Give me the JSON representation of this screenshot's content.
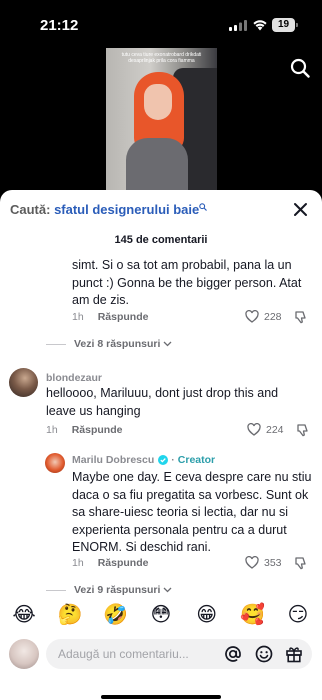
{
  "status_bar": {
    "time": "21:12",
    "battery": "19"
  },
  "video": {
    "caption": "tutu ceva tiure exonatrobard drikdati desaprlinjak prila cora fiamma"
  },
  "comments_sheet": {
    "search_prefix": "Caută: ",
    "search_term": "sfatul designerului baie",
    "count_label": "145 de comentarii"
  },
  "comments": [
    {
      "text_lines": [
        "simt. Si o sa tot am probabil, pana la un",
        "punct :) Gonna be the bigger person. Atat",
        "am de zis."
      ],
      "age": "1h",
      "reply_label": "Răspunde",
      "likes": "228",
      "view_replies": "Vezi 8 răspunsuri"
    },
    {
      "author": "blondezaur",
      "text_lines": [
        "helloooo, Mariluuu, dont just drop this and",
        "leave us hanging"
      ],
      "age": "1h",
      "reply_label": "Răspunde",
      "likes": "224"
    },
    {
      "author": "Marilu Dobrescu",
      "separator": "·",
      "badge": "Creator",
      "text_lines": [
        "Maybe one day. E ceva despre care nu stiu",
        "daca o sa fiu pregatita sa vorbesc. Sunt ok",
        "sa share-uiesc teoria si lectia, dar nu si",
        "experienta personala pentru ca a durut",
        "ENORM. Si deschid rani."
      ],
      "age": "1h",
      "reply_label": "Răspunde",
      "likes": "353",
      "view_replies": "Vezi 9 răspunsuri"
    }
  ],
  "emoji_bar": [
    "😂",
    "🤔",
    "🤣",
    "😳",
    "😁",
    "🥰",
    "😏"
  ],
  "input": {
    "placeholder": "Adaugă un comentariu..."
  },
  "colors": {
    "search_term": "#2b5db9",
    "creator_badge": "#2c9eaa",
    "verified": "#20d5ec"
  },
  "icons": [
    "search-icon",
    "close-icon",
    "heart-icon",
    "dislike-icon",
    "chevron-down-icon",
    "verified-icon",
    "mention-icon",
    "emoji-icon",
    "gift-icon"
  ]
}
